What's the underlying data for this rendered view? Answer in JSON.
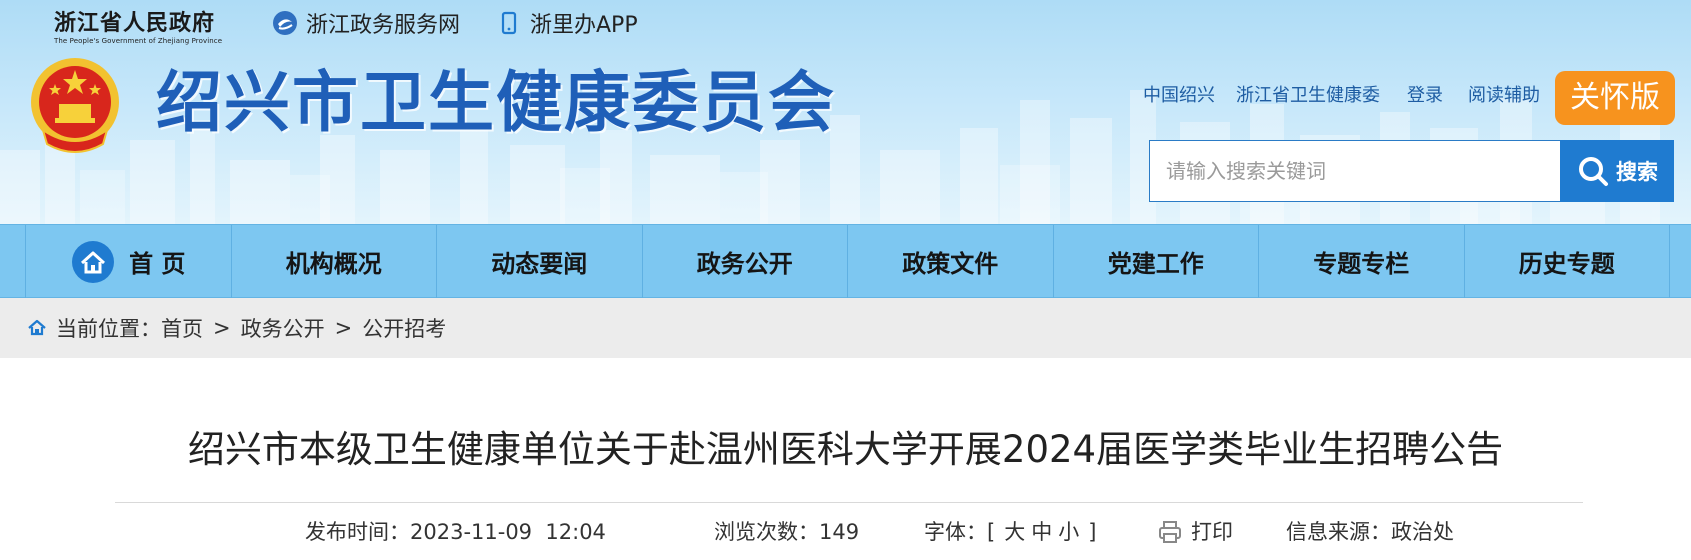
{
  "topbar": {
    "provincial_gov": {
      "name_cn": "浙江省人民政府",
      "name_en": "The People's Government of Zhejiang Province"
    },
    "links": [
      {
        "label": "浙江政务服务网",
        "icon": "service-network-icon"
      },
      {
        "label": "浙里办APP",
        "icon": "mobile-phone-icon"
      }
    ]
  },
  "header": {
    "title": "绍兴市卫生健康委员会",
    "emblem": "national-emblem-icon",
    "utility_links": [
      "中国绍兴",
      "浙江省卫生健康委",
      "登录",
      "阅读辅助"
    ],
    "care_mode_label": "关怀版"
  },
  "search": {
    "placeholder": "请输入搜索关键词",
    "value": "",
    "button_label": "搜索",
    "icon": "search-icon"
  },
  "nav": {
    "items": [
      {
        "label": "首 页",
        "icon": "home-icon"
      },
      {
        "label": "机构概况"
      },
      {
        "label": "动态要闻"
      },
      {
        "label": "政务公开"
      },
      {
        "label": "政策文件"
      },
      {
        "label": "党建工作"
      },
      {
        "label": "专题专栏"
      },
      {
        "label": "历史专题"
      }
    ]
  },
  "breadcrumb": {
    "prefix": "当前位置：",
    "separator": ">",
    "items": [
      "首页",
      "政务公开",
      "公开招考"
    ]
  },
  "article": {
    "title": "绍兴市本级卫生健康单位关于赴温州医科大学开展2024届医学类毕业生招聘公告",
    "publish_label": "发布时间：",
    "publish_time": "2023-11-09  12:04",
    "views_label": "浏览次数：",
    "views": "149",
    "font_label": "字体：",
    "font_open": "[",
    "font_sizes": [
      "大",
      "中",
      "小"
    ],
    "font_close": "]",
    "print_label": "打印",
    "source_label": "信息来源：",
    "source": "政治处"
  },
  "colors": {
    "header_bg": "#aedcf6",
    "title_blue": "#1f5fb8",
    "nav_bg": "#7dc7f1",
    "care_orange": "#f7931e",
    "search_blue": "#1f7bd0",
    "crumb_bg": "#ececec"
  }
}
